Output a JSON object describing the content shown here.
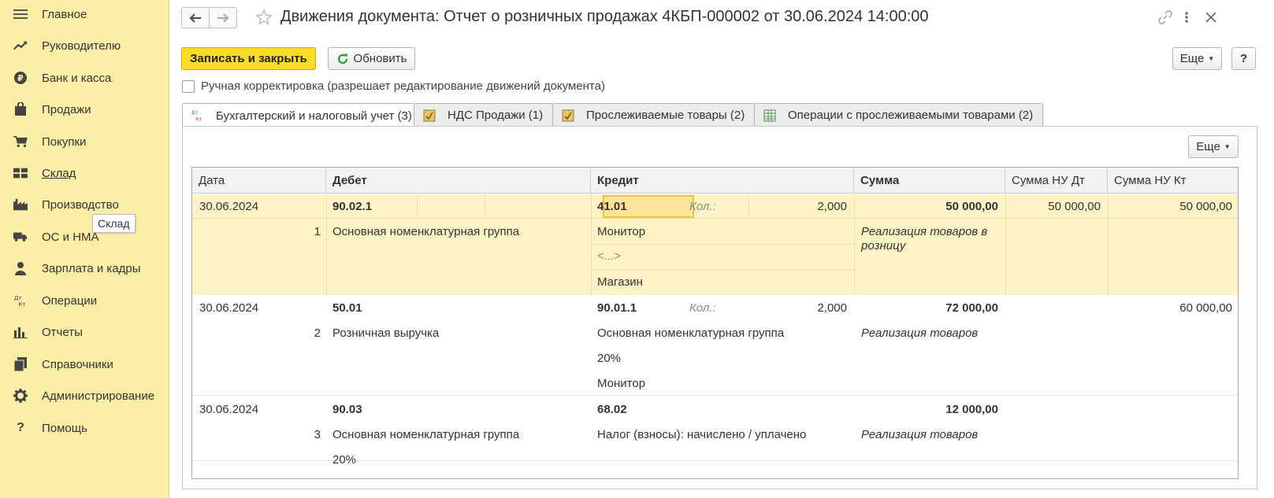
{
  "sidebar": {
    "items": [
      {
        "label": "Главное",
        "icon": "menu-icon"
      },
      {
        "label": "Руководителю",
        "icon": "trend-icon"
      },
      {
        "label": "Банк и касса",
        "icon": "ruble-icon"
      },
      {
        "label": "Продажи",
        "icon": "bag-icon"
      },
      {
        "label": "Покупки",
        "icon": "cart-icon"
      },
      {
        "label": "Склад",
        "icon": "warehouse-icon"
      },
      {
        "label": "Производство",
        "icon": "factory-icon"
      },
      {
        "label": "ОС и НМА",
        "icon": "truck-icon"
      },
      {
        "label": "Зарплата и кадры",
        "icon": "person-icon"
      },
      {
        "label": "Операции",
        "icon": "dt-kt-icon"
      },
      {
        "label": "Отчеты",
        "icon": "bar-chart-icon"
      },
      {
        "label": "Справочники",
        "icon": "books-icon"
      },
      {
        "label": "Администрирование",
        "icon": "gear-icon"
      },
      {
        "label": "Помощь",
        "icon": "help-icon"
      }
    ],
    "tooltip": "Склад"
  },
  "header": {
    "title": "Движения документа: Отчет о розничных продажах 4КБП-000002 от 30.06.2024 14:00:00"
  },
  "toolbar": {
    "save_close": "Записать и закрыть",
    "refresh": "Обновить",
    "more": "Еще",
    "help": "?",
    "manual_correction": "Ручная корректировка (разрешает редактирование движений документа)"
  },
  "tabs": [
    {
      "label": "Бухгалтерский и налоговый учет (3)",
      "icon": "dt-kt-icon",
      "active": true
    },
    {
      "label": "НДС Продажи (1)",
      "icon": "register-icon",
      "active": false
    },
    {
      "label": "Прослеживаемые товары (2)",
      "icon": "register-icon",
      "active": false
    },
    {
      "label": "Операции с прослеживаемыми товарами (2)",
      "icon": "table-icon",
      "active": false
    }
  ],
  "table": {
    "more": "Еще",
    "columns": [
      "Дата",
      "Дебет",
      "Кредит",
      "Сумма",
      "Сумма НУ Дт",
      "Сумма НУ Кт"
    ],
    "qty_label": "Кол.:",
    "rows": [
      {
        "date": "30.06.2024",
        "num": "1",
        "debit": "90.02.1",
        "debit_sub": [
          "Основная номенклатурная группа"
        ],
        "credit": "41.01",
        "credit_qty": "2,000",
        "credit_sub": [
          "Монитор",
          "<...>",
          "Магазин"
        ],
        "sum": "50 000,00",
        "content": "Реализация товаров в розницу",
        "nu_dt": "50 000,00",
        "nu_kt": "50 000,00"
      },
      {
        "date": "30.06.2024",
        "num": "2",
        "debit": "50.01",
        "debit_sub": [
          "Розничная выручка"
        ],
        "credit": "90.01.1",
        "credit_qty": "2,000",
        "credit_sub": [
          "Основная номенклатурная группа",
          "20%",
          "Монитор"
        ],
        "sum": "72 000,00",
        "content": "Реализация товаров",
        "nu_dt": "",
        "nu_kt": "60 000,00"
      },
      {
        "date": "30.06.2024",
        "num": "3",
        "debit": "90.03",
        "debit_sub": [
          "Основная номенклатурная группа",
          "20%"
        ],
        "credit": "68.02",
        "credit_qty": "",
        "credit_sub": [
          "Налог (взносы): начислено / уплачено"
        ],
        "sum": "12 000,00",
        "content": "Реализация товаров",
        "nu_dt": "",
        "nu_kt": ""
      }
    ]
  }
}
